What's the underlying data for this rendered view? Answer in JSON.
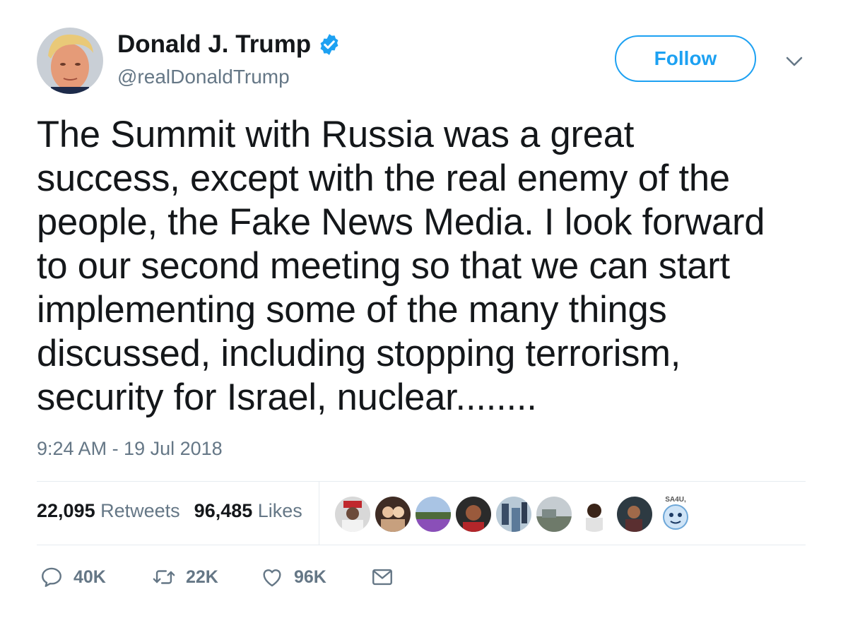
{
  "author": {
    "display_name": "Donald J. Trump",
    "handle": "@realDonaldTrump",
    "verified": true,
    "avatar_icon": "profile-photo"
  },
  "follow_button": {
    "label": "Follow"
  },
  "menu_icon": "chevron-down-icon",
  "tweet": {
    "text": "The Summit with Russia was a great\nsuccess, except with the real enemy of the\npeople, the Fake News Media. I look forward\nto our second meeting so that we can start\nimplementing some of the many things\ndiscussed, including stopping terrorism,\nsecurity for Israel, nuclear........",
    "timestamp": "9:24 AM - 19 Jul 2018"
  },
  "stats": {
    "retweets_count": "22,095",
    "retweets_label": "Retweets",
    "likes_count": "96,485",
    "likes_label": "Likes"
  },
  "likers": [
    {
      "icon": "liker-avatar"
    },
    {
      "icon": "liker-avatar"
    },
    {
      "icon": "liker-avatar"
    },
    {
      "icon": "liker-avatar"
    },
    {
      "icon": "liker-avatar"
    },
    {
      "icon": "liker-avatar"
    },
    {
      "icon": "liker-avatar"
    },
    {
      "icon": "liker-avatar"
    },
    {
      "icon": "liker-avatar",
      "text": "SA4U,"
    }
  ],
  "actions": {
    "reply_count": "40K",
    "retweet_count": "22K",
    "like_count": "96K"
  },
  "colors": {
    "accent": "#1da1f2",
    "text": "#14171a",
    "secondary": "#657786",
    "divider": "#e6ecf0"
  }
}
